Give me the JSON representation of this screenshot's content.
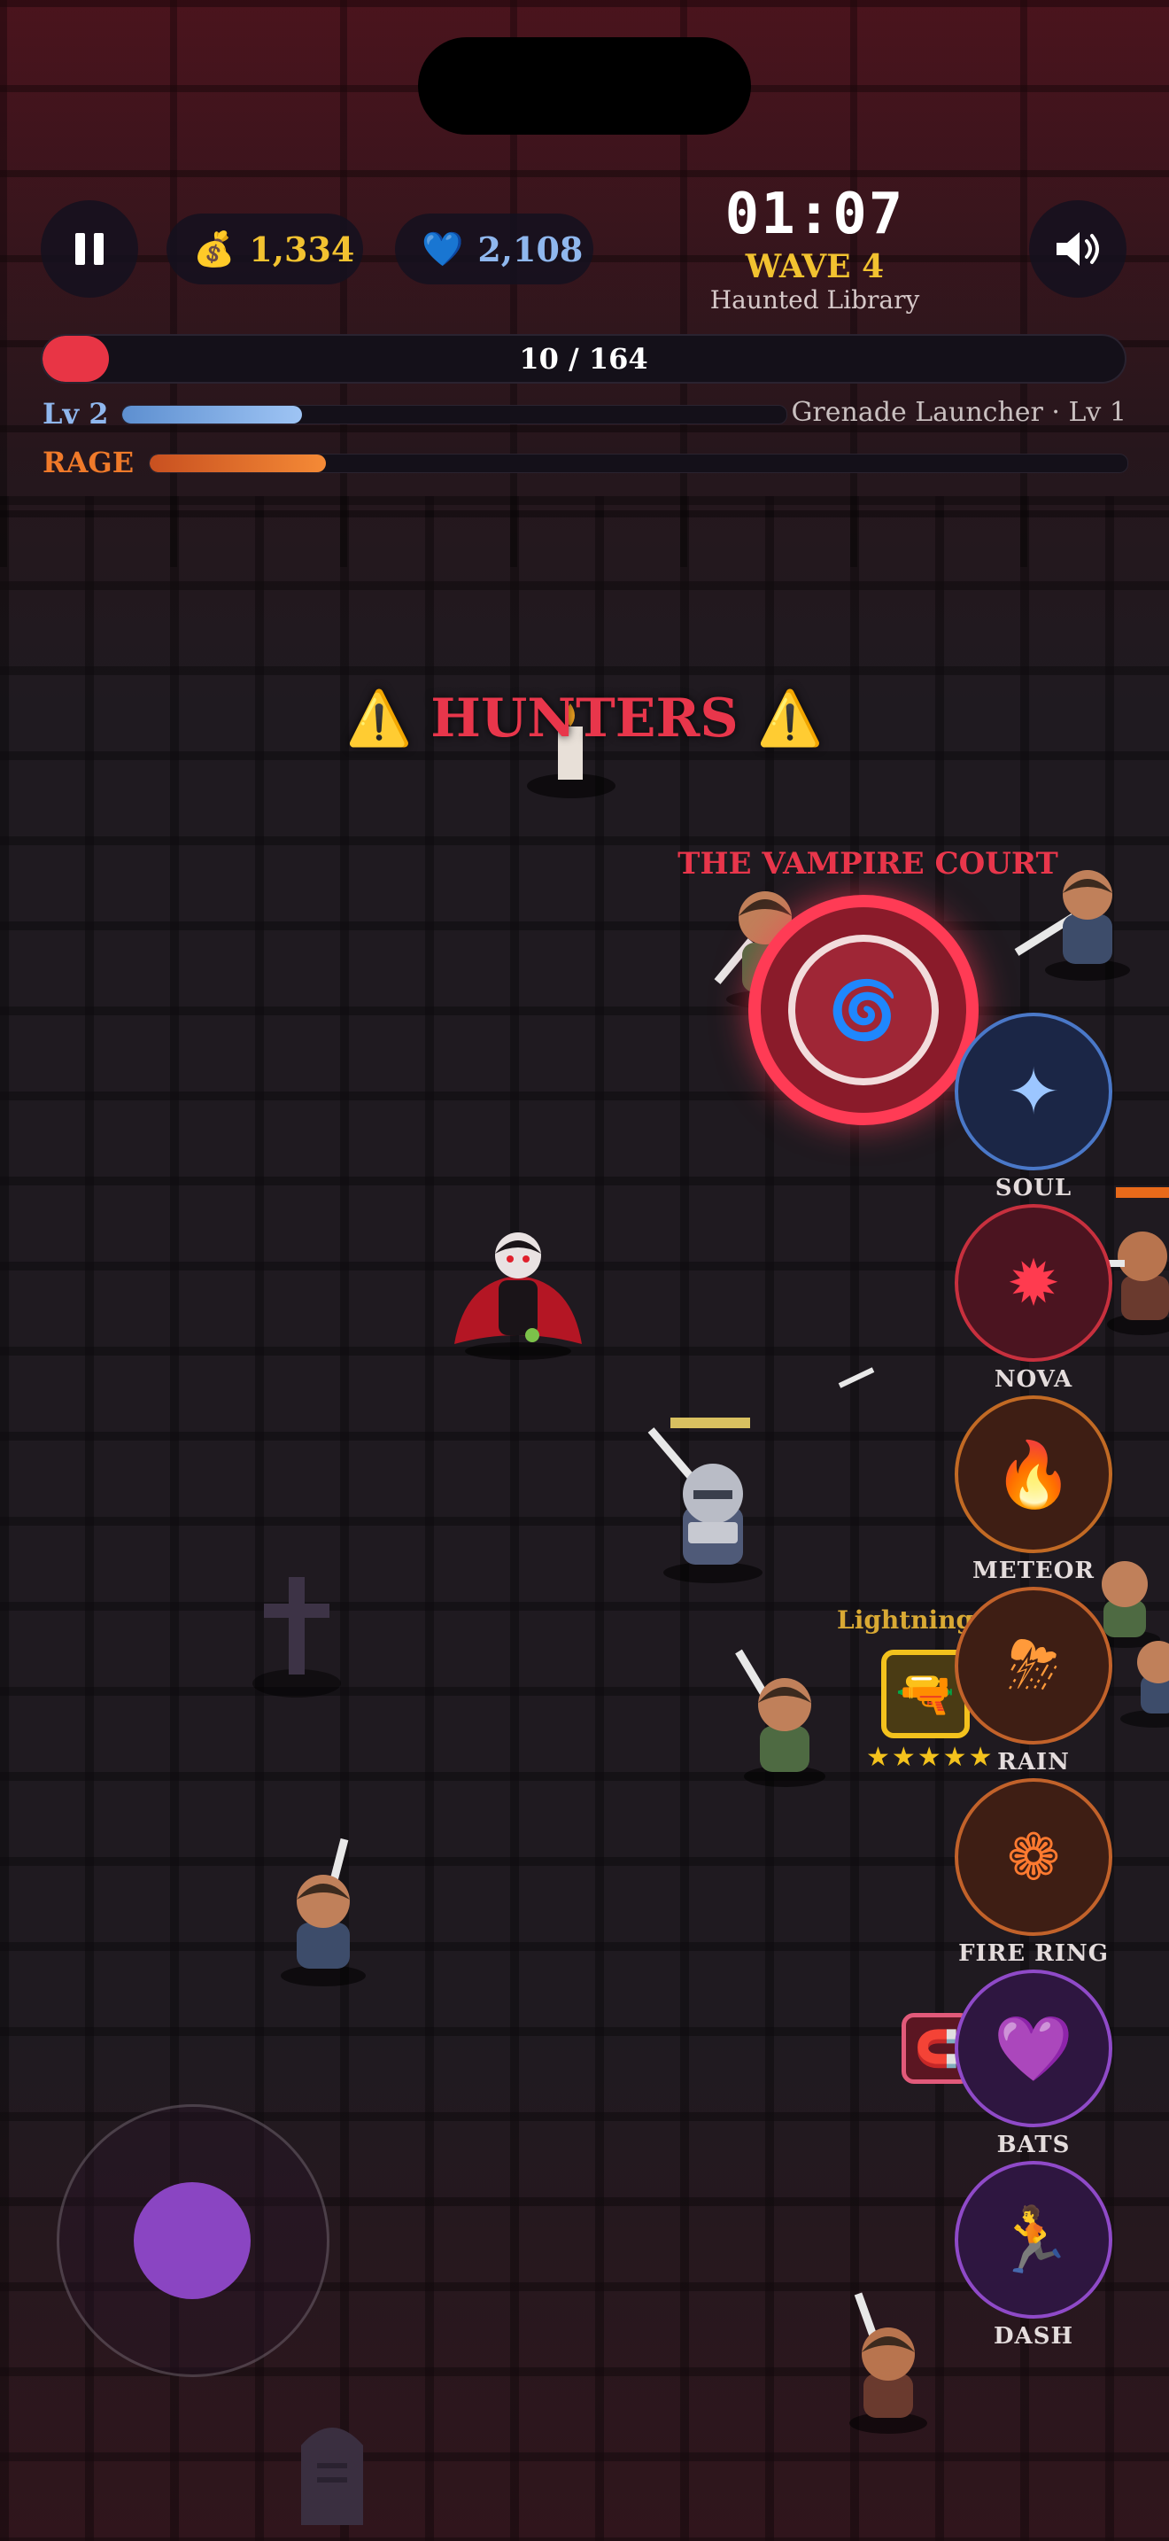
{
  "hud": {
    "gold": "1,334",
    "gems": "2,108",
    "timer": "01:07",
    "wave": "WAVE 4",
    "stage": "Haunted Library",
    "hp_text": "10 / 164",
    "hp_fraction": 0.061,
    "level_label": "Lv 2",
    "xp_fraction": 0.27,
    "weapon_label": "Grenade Launcher · Lv 1",
    "rage_label": "RAGE",
    "rage_fraction": 0.18
  },
  "icons": {
    "pause": "pause-icon",
    "gold": "money-bag-icon",
    "gems": "blue-heart-icon",
    "sound": "speaker-icon"
  },
  "banner": {
    "warn_glyph": "⚠️",
    "text": "HUNTERS"
  },
  "boss": {
    "label": "THE VAMPIRE COURT",
    "glyph": "🌀"
  },
  "skills": [
    {
      "label": "SOUL",
      "glyph": "✦",
      "border": "#4a78c8",
      "bg": "#1b2646",
      "color": "#9cc6ff"
    },
    {
      "label": "NOVA",
      "glyph": "✹",
      "border": "#c8303e",
      "bg": "#4b1420",
      "color": "#ff3b4f"
    },
    {
      "label": "METEOR",
      "glyph": "🔥",
      "border": "#c26a24",
      "bg": "#3e1e14",
      "color": "#ff8a2a"
    },
    {
      "label": "RAIN",
      "glyph": "⛈",
      "border": "#c2622a",
      "bg": "#3e1e14",
      "color": "#ff9a3a"
    },
    {
      "label": "FIRE RING",
      "glyph": "❁",
      "border": "#c2622a",
      "bg": "#3e1e14",
      "color": "#ff7a30"
    },
    {
      "label": "BATS",
      "glyph": "💜",
      "border": "#8f4ac8",
      "bg": "#2e1640",
      "color": "#b46cf0"
    },
    {
      "label": "DASH",
      "glyph": "🏃",
      "border": "#8f4ac8",
      "bg": "#2e1640",
      "color": "#b46cf0"
    }
  ],
  "pickup": {
    "label": "Lightning Gun",
    "glyph": "🔫",
    "stars": "★★★★★"
  },
  "magnet": {
    "glyph": "🧲"
  },
  "colors": {
    "accent_red": "#e83545",
    "gold": "#f2c230",
    "xp_blue": "#8fb7ee",
    "rage_orange": "#f07a2a"
  }
}
